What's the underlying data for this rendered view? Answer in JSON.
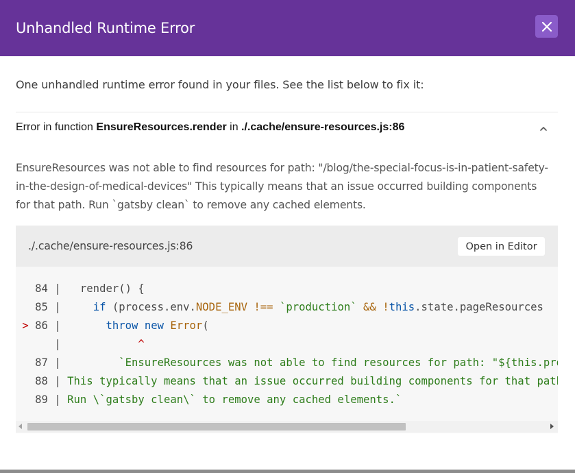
{
  "header": {
    "title": "Unhandled Runtime Error",
    "close_icon": "close-icon",
    "background": "#663399"
  },
  "summary": "One unhandled runtime error found in your files. See the list below to fix it:",
  "error": {
    "prefix": "Error in function ",
    "function": "EnsureResources.render",
    "middle": " in ",
    "location": "./.cache/ensure-resources.js:86",
    "toggle_icon": "chevron-up-icon",
    "message": "EnsureResources was not able to find resources for path: \"/blog/the-special-focus-is-in-patient-safety-in-the-design-of-medical-devices\" This typically means that an issue occurred building components for that path. Run `gatsby clean` to remove any cached elements."
  },
  "code_frame": {
    "file": "./.cache/ensure-resources.js:86",
    "open_editor_label": "Open in Editor",
    "lines": [
      {
        "marker": " ",
        "num": "84",
        "parts": [
          {
            "t": "  render() {",
            "c": ""
          }
        ]
      },
      {
        "marker": " ",
        "num": "85",
        "parts": [
          {
            "t": "    ",
            "c": ""
          },
          {
            "t": "if",
            "c": "kw"
          },
          {
            "t": " (process.env.",
            "c": ""
          },
          {
            "t": "NODE_ENV",
            "c": "prop"
          },
          {
            "t": " ",
            "c": ""
          },
          {
            "t": "!==",
            "c": "prop"
          },
          {
            "t": " ",
            "c": ""
          },
          {
            "t": "`production`",
            "c": "str"
          },
          {
            "t": " ",
            "c": ""
          },
          {
            "t": "&&",
            "c": "prop"
          },
          {
            "t": " ",
            "c": ""
          },
          {
            "t": "!",
            "c": "prop"
          },
          {
            "t": "this",
            "c": "kw"
          },
          {
            "t": ".state.",
            "c": ""
          },
          {
            "t": "pageResources",
            "c": ""
          }
        ]
      },
      {
        "marker": ">",
        "num": "86",
        "parts": [
          {
            "t": "      ",
            "c": ""
          },
          {
            "t": "throw",
            "c": "kw"
          },
          {
            "t": " ",
            "c": ""
          },
          {
            "t": "new",
            "c": "kw"
          },
          {
            "t": " ",
            "c": ""
          },
          {
            "t": "Error",
            "c": "prop"
          },
          {
            "t": "(",
            "c": ""
          }
        ]
      },
      {
        "marker": " ",
        "num": "",
        "parts": [
          {
            "t": "           ",
            "c": ""
          },
          {
            "t": "^",
            "c": "caret"
          }
        ]
      },
      {
        "marker": " ",
        "num": "87",
        "parts": [
          {
            "t": "        ",
            "c": ""
          },
          {
            "t": "`EnsureResources was not able to find resources for path: \"${this.props.location.pathname}\"",
            "c": "str"
          }
        ]
      },
      {
        "marker": " ",
        "num": "88",
        "parts": [
          {
            "t": "This typically means that an issue occurred building components for that path.",
            "c": "str"
          }
        ]
      },
      {
        "marker": " ",
        "num": "89",
        "parts": [
          {
            "t": "Run \\`gatsby clean\\` to remove any cached elements.`",
            "c": "str"
          }
        ]
      }
    ]
  }
}
